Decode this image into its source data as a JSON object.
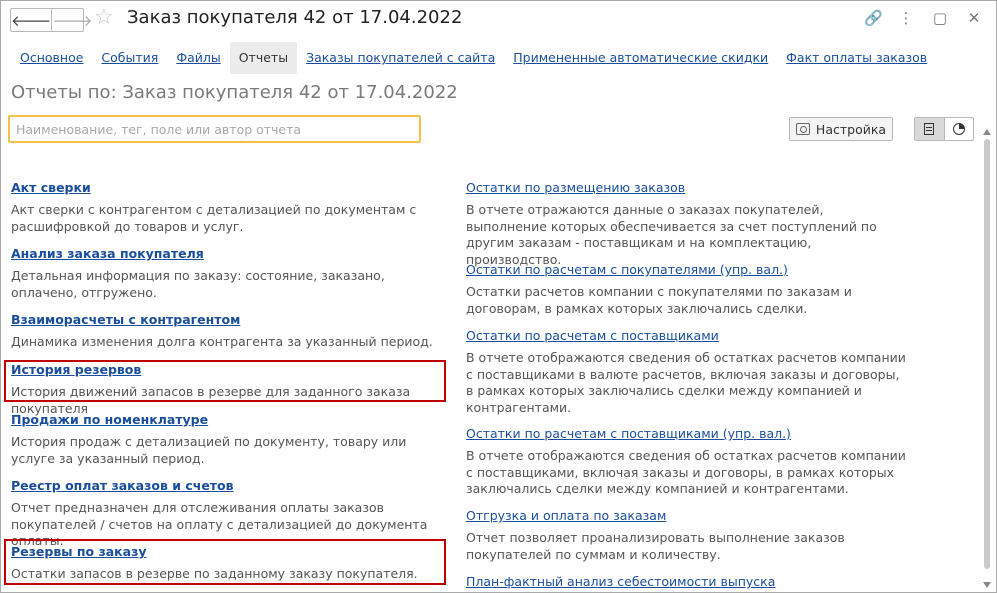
{
  "window": {
    "title": "Заказ покупателя 42 от 17.04.2022",
    "nav_back": "🡐",
    "nav_forward": "🡒",
    "star": "☆",
    "icons": [
      "link-icon",
      "more-icon",
      "maximize-icon",
      "close-icon"
    ],
    "icon_glyphs": {
      "link": "🔗",
      "more": "⋮",
      "maximize": "▢",
      "close": "✕"
    }
  },
  "tabs": [
    {
      "label": "Основное",
      "active": false
    },
    {
      "label": "События",
      "active": false
    },
    {
      "label": "Файлы",
      "active": false
    },
    {
      "label": "Отчеты",
      "active": true
    },
    {
      "label": "Заказы покупателей с сайта",
      "active": false
    },
    {
      "label": "Примененные автоматические скидки",
      "active": false
    },
    {
      "label": "Факт оплаты заказов",
      "active": false
    }
  ],
  "subtitle": "Отчеты по: Заказ покупателя 42 от 17.04.2022",
  "search": {
    "placeholder": "Наименование, тег, поле или автор отчета",
    "value": ""
  },
  "settings_label": "Настройка",
  "highlight_color": "#c00000",
  "reports_left": [
    {
      "title": "Акт сверки",
      "desc": "Акт сверки с контрагентом с детализацией по документам с расшифровкой до товаров и услуг."
    },
    {
      "title": "Анализ заказа покупателя",
      "desc": "Детальная информация по заказу: состояние, заказано, оплачено, отгружено."
    },
    {
      "title": "Взаиморасчеты с контрагентом",
      "desc": "Динамика изменения долга контрагента за указанный период."
    },
    {
      "title": "История резервов",
      "desc": "История движений запасов в резерве для заданного заказа покупателя"
    },
    {
      "title": "Продажи по номенклатуре",
      "desc": "История продаж с детализацией по документу, товару или услуге за указанный период."
    },
    {
      "title": "Реестр оплат заказов и счетов",
      "desc": "Отчет предназначен для отслеживания оплаты заказов покупателей / счетов на оплату с детализацией до документа оплаты."
    },
    {
      "title": "Резервы по заказу",
      "desc": "Остатки запасов в резерве по заданному заказу покупателя."
    }
  ],
  "reports_right": [
    {
      "title": "Остатки по размещению заказов",
      "desc": "В отчете отражаются данные о заказах покупателей, выполнение которых обеспечивается за счет поступлений по другим заказам - поставщикам и на комплектацию, производство."
    },
    {
      "title": "Остатки по расчетам с покупателями (упр. вал.)",
      "desc": "Остатки расчетов компании с покупателями по заказам и договорам, в рамках которых заключались сделки."
    },
    {
      "title": "Остатки по расчетам с поставщиками",
      "desc": "В отчете отображаются сведения об остатках расчетов компании с поставщиками в валюте расчетов, включая заказы и договоры, в рамках которых заключались сделки между компанией и контрагентами."
    },
    {
      "title": "Остатки по расчетам с поставщиками (упр. вал.)",
      "desc": "В отчете отображаются сведения об остатках расчетов компании с поставщиками, включая заказы и договоры, в рамках которых заключались сделки между компанией и контрагентами."
    },
    {
      "title": "Отгрузка и оплата по заказам",
      "desc": "Отчет позволяет проанализировать выполнение заказов покупателей по суммам и количеству."
    },
    {
      "title": "План-фактный анализ себестоимости выпуска",
      "desc": ""
    }
  ]
}
